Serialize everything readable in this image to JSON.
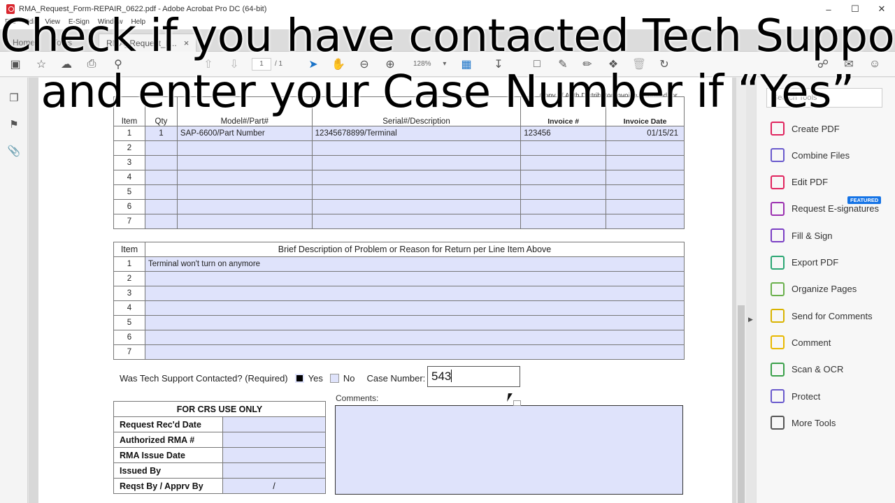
{
  "window": {
    "title": "RMA_Request_Form-REPAIR_0622.pdf - Adobe Acrobat Pro DC (64-bit)",
    "controls": [
      "–",
      "☐",
      "✕"
    ]
  },
  "menu": [
    "File",
    "Edit",
    "View",
    "E-Sign",
    "Window",
    "Help"
  ],
  "tabs": [
    {
      "label": "Home"
    },
    {
      "label": "Tools"
    },
    {
      "label": "RMA_Request_F...",
      "close": "×"
    }
  ],
  "toolbar": {
    "page_current": "1",
    "page_total": "/ 1",
    "zoom": "128%"
  },
  "form": {
    "parts_header": {
      "item": "Item",
      "qty": "Qty",
      "model": "Model#/Part#",
      "serial": "Serial#/Description",
      "invoice_note": "Copy of Auth Distributor Invoice (required for warranty & returns), or",
      "invoice_num": "Invoice #",
      "invoice_date": "Invoice Date"
    },
    "parts_rows": [
      {
        "item": "1",
        "qty": "1",
        "model": "SAP-6600/Part Number",
        "serial": "12345678899/Terminal",
        "invoice": "123456",
        "date": "01/15/21"
      },
      {
        "item": "2",
        "qty": "",
        "model": "",
        "serial": "",
        "invoice": "",
        "date": ""
      },
      {
        "item": "3",
        "qty": "",
        "model": "",
        "serial": "",
        "invoice": "",
        "date": ""
      },
      {
        "item": "4",
        "qty": "",
        "model": "",
        "serial": "",
        "invoice": "",
        "date": ""
      },
      {
        "item": "5",
        "qty": "",
        "model": "",
        "serial": "",
        "invoice": "",
        "date": ""
      },
      {
        "item": "6",
        "qty": "",
        "model": "",
        "serial": "",
        "invoice": "",
        "date": ""
      },
      {
        "item": "7",
        "qty": "",
        "model": "",
        "serial": "",
        "invoice": "",
        "date": ""
      }
    ],
    "problem_header": {
      "item": "Item",
      "desc": "Brief Description of Problem or Reason for Return per Line Item Above"
    },
    "problem_rows": [
      {
        "item": "1",
        "desc": "Terminal won't turn on anymore"
      },
      {
        "item": "2",
        "desc": ""
      },
      {
        "item": "3",
        "desc": ""
      },
      {
        "item": "4",
        "desc": ""
      },
      {
        "item": "5",
        "desc": ""
      },
      {
        "item": "6",
        "desc": ""
      },
      {
        "item": "7",
        "desc": ""
      }
    ],
    "tech_support": {
      "question": "Was Tech Support Contacted? (Required)",
      "yes_label": "Yes",
      "no_label": "No",
      "case_label": "Case Number:",
      "case_value": "543"
    },
    "crs": {
      "title": "FOR CRS USE ONLY",
      "rows": [
        {
          "label": "Request Rec'd Date",
          "value": ""
        },
        {
          "label": "Authorized RMA #",
          "value": ""
        },
        {
          "label": "RMA Issue Date",
          "value": ""
        },
        {
          "label": "Issued By",
          "value": ""
        },
        {
          "label": "Reqst By / Apprv By",
          "value": "/"
        }
      ]
    },
    "comments_label": "Comments:"
  },
  "tools_pane": {
    "search_placeholder": "Search Tools",
    "featured_badge": "FEATURED",
    "tools": [
      {
        "label": "Create PDF",
        "icon": "create-pdf-icon",
        "color": "#e0245e"
      },
      {
        "label": "Combine Files",
        "icon": "combine-files-icon",
        "color": "#6a5acd"
      },
      {
        "label": "Edit PDF",
        "icon": "edit-pdf-icon",
        "color": "#e0245e"
      },
      {
        "label": "Request E-signatures",
        "icon": "request-esign-icon",
        "color": "#9b30b0"
      },
      {
        "label": "Fill & Sign",
        "icon": "fill-sign-icon",
        "color": "#7b3fc4"
      },
      {
        "label": "Export PDF",
        "icon": "export-pdf-icon",
        "color": "#2aa673"
      },
      {
        "label": "Organize Pages",
        "icon": "organize-pages-icon",
        "color": "#6ab04c"
      },
      {
        "label": "Send for Comments",
        "icon": "send-comments-icon",
        "color": "#d9b300"
      },
      {
        "label": "Comment",
        "icon": "comment-icon",
        "color": "#e8b800"
      },
      {
        "label": "Scan & OCR",
        "icon": "scan-ocr-icon",
        "color": "#3aa04a"
      },
      {
        "label": "Protect",
        "icon": "protect-icon",
        "color": "#6a5acd"
      },
      {
        "label": "More Tools",
        "icon": "more-tools-icon",
        "color": "#555555"
      }
    ]
  },
  "caption": {
    "line1": "Check if you have contacted Tech Support",
    "line2": "and enter your Case Number if “Yes”"
  },
  "colors": {
    "field_fill": "#dfe3fb",
    "acrobat_red": "#d9262e",
    "featured_blue": "#1473e6"
  }
}
